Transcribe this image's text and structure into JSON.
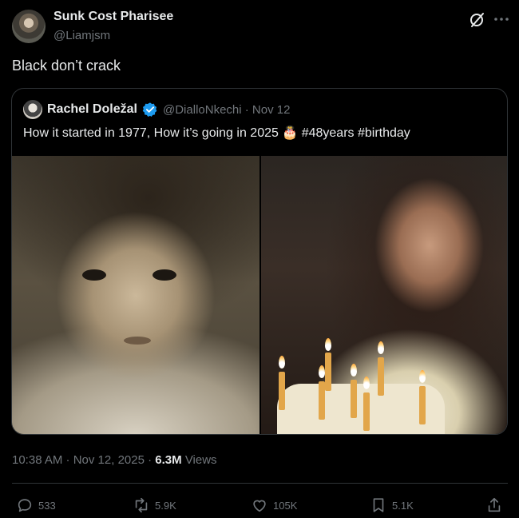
{
  "post": {
    "author_name": "Sunk Cost Pharisee",
    "author_handle": "@Liamjsm",
    "text": "Black don’t crack",
    "timestamp": "10:38 AM · Nov 12, 2025 · ",
    "views_count": "6.3M",
    "views_label": "Views"
  },
  "quote": {
    "author_name": "Rachel Doležal",
    "author_meta": "@DialloNkechi · Nov 12",
    "text": "How it started in 1977, How it’s going in 2025 🎂 #48years #birthday"
  },
  "actions": {
    "replies": "533",
    "reposts": "5.9K",
    "likes": "105K",
    "bookmarks": "5.1K"
  },
  "icons": {
    "grok": "grok-icon",
    "more": "more-icon",
    "verified": "verified-badge-icon",
    "reply": "reply-icon",
    "repost": "repost-icon",
    "like": "like-icon",
    "bookmark": "bookmark-icon",
    "share": "share-icon"
  },
  "colors": {
    "background": "#000000",
    "text": "#e7e9ea",
    "muted": "#71767b",
    "verified": "#1d9bf0",
    "border": "#2f3336"
  }
}
